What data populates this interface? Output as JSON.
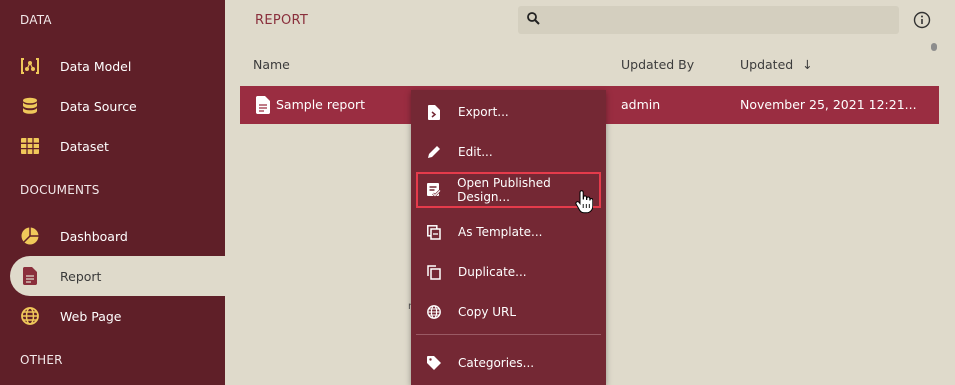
{
  "sidebar": {
    "sections": [
      {
        "label": "DATA"
      },
      {
        "label": "DOCUMENTS"
      },
      {
        "label": "OTHER"
      }
    ],
    "items": [
      {
        "label": "Data Model",
        "icon": "data-model-icon"
      },
      {
        "label": "Data Source",
        "icon": "database-icon"
      },
      {
        "label": "Dataset",
        "icon": "grid-icon"
      },
      {
        "label": "Dashboard",
        "icon": "pie-chart-icon"
      },
      {
        "label": "Report",
        "icon": "document-icon"
      },
      {
        "label": "Web Page",
        "icon": "globe-icon"
      }
    ]
  },
  "header": {
    "title": "REPORT",
    "search_placeholder": ""
  },
  "table": {
    "columns": [
      "Name",
      "Updated By",
      "Updated"
    ],
    "sort_indicator": "↓",
    "rows": [
      {
        "name": "Sample report",
        "updated_by": "admin",
        "updated": "November 25, 2021 12:21..."
      }
    ]
  },
  "stray_text": "n",
  "context_menu": {
    "items": [
      {
        "label": "Export...",
        "icon": "export-icon"
      },
      {
        "label": "Edit...",
        "icon": "pencil-icon"
      },
      {
        "label": "Open Published Design...",
        "icon": "published-design-icon"
      },
      {
        "label": "As Template...",
        "icon": "template-icon"
      },
      {
        "label": "Duplicate...",
        "icon": "duplicate-icon"
      },
      {
        "label": "Copy URL",
        "icon": "globe-icon"
      },
      {
        "label": "Categories...",
        "icon": "tag-icon"
      }
    ],
    "highlighted": "Open Published Design..."
  },
  "colors": {
    "sidebar": "#5f1f28",
    "accent_yellow": "#f0c85a",
    "selected_row": "#9a2d41",
    "menu": "#742834",
    "highlight_border": "#e53b4b",
    "content_bg": "#dfdacb"
  }
}
